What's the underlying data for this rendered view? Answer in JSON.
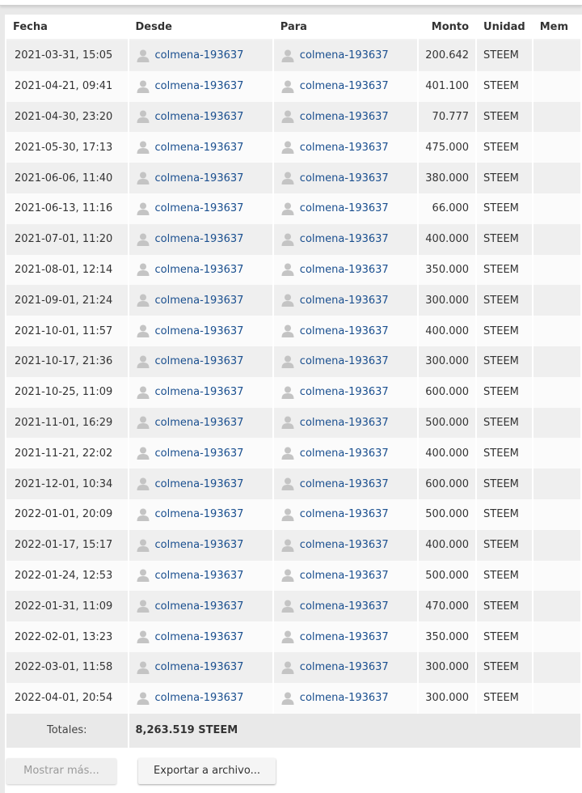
{
  "table": {
    "headers": {
      "fecha": "Fecha",
      "desde": "Desde",
      "para": "Para",
      "monto": "Monto",
      "unidad": "Unidad",
      "memo": "Mem"
    },
    "rows": [
      {
        "fecha": "2021-03-31, 15:05",
        "desde": "colmena-193637",
        "para": "colmena-193637",
        "monto": "200.642",
        "unidad": "STEEM"
      },
      {
        "fecha": "2021-04-21, 09:41",
        "desde": "colmena-193637",
        "para": "colmena-193637",
        "monto": "401.100",
        "unidad": "STEEM"
      },
      {
        "fecha": "2021-04-30, 23:20",
        "desde": "colmena-193637",
        "para": "colmena-193637",
        "monto": "70.777",
        "unidad": "STEEM"
      },
      {
        "fecha": "2021-05-30, 17:13",
        "desde": "colmena-193637",
        "para": "colmena-193637",
        "monto": "475.000",
        "unidad": "STEEM"
      },
      {
        "fecha": "2021-06-06, 11:40",
        "desde": "colmena-193637",
        "para": "colmena-193637",
        "monto": "380.000",
        "unidad": "STEEM"
      },
      {
        "fecha": "2021-06-13, 11:16",
        "desde": "colmena-193637",
        "para": "colmena-193637",
        "monto": "66.000",
        "unidad": "STEEM"
      },
      {
        "fecha": "2021-07-01, 11:20",
        "desde": "colmena-193637",
        "para": "colmena-193637",
        "monto": "400.000",
        "unidad": "STEEM"
      },
      {
        "fecha": "2021-08-01, 12:14",
        "desde": "colmena-193637",
        "para": "colmena-193637",
        "monto": "350.000",
        "unidad": "STEEM"
      },
      {
        "fecha": "2021-09-01, 21:24",
        "desde": "colmena-193637",
        "para": "colmena-193637",
        "monto": "300.000",
        "unidad": "STEEM"
      },
      {
        "fecha": "2021-10-01, 11:57",
        "desde": "colmena-193637",
        "para": "colmena-193637",
        "monto": "400.000",
        "unidad": "STEEM"
      },
      {
        "fecha": "2021-10-17, 21:36",
        "desde": "colmena-193637",
        "para": "colmena-193637",
        "monto": "300.000",
        "unidad": "STEEM"
      },
      {
        "fecha": "2021-10-25, 11:09",
        "desde": "colmena-193637",
        "para": "colmena-193637",
        "monto": "600.000",
        "unidad": "STEEM"
      },
      {
        "fecha": "2021-11-01, 16:29",
        "desde": "colmena-193637",
        "para": "colmena-193637",
        "monto": "500.000",
        "unidad": "STEEM"
      },
      {
        "fecha": "2021-11-21, 22:02",
        "desde": "colmena-193637",
        "para": "colmena-193637",
        "monto": "400.000",
        "unidad": "STEEM"
      },
      {
        "fecha": "2021-12-01, 10:34",
        "desde": "colmena-193637",
        "para": "colmena-193637",
        "monto": "600.000",
        "unidad": "STEEM"
      },
      {
        "fecha": "2022-01-01, 20:09",
        "desde": "colmena-193637",
        "para": "colmena-193637",
        "monto": "500.000",
        "unidad": "STEEM"
      },
      {
        "fecha": "2022-01-17, 15:17",
        "desde": "colmena-193637",
        "para": "colmena-193637",
        "monto": "400.000",
        "unidad": "STEEM"
      },
      {
        "fecha": "2022-01-24, 12:53",
        "desde": "colmena-193637",
        "para": "colmena-193637",
        "monto": "500.000",
        "unidad": "STEEM"
      },
      {
        "fecha": "2022-01-31, 11:09",
        "desde": "colmena-193637",
        "para": "colmena-193637",
        "monto": "470.000",
        "unidad": "STEEM"
      },
      {
        "fecha": "2022-02-01, 13:23",
        "desde": "colmena-193637",
        "para": "colmena-193637",
        "monto": "350.000",
        "unidad": "STEEM"
      },
      {
        "fecha": "2022-03-01, 11:58",
        "desde": "colmena-193637",
        "para": "colmena-193637",
        "monto": "300.000",
        "unidad": "STEEM"
      },
      {
        "fecha": "2022-04-01, 20:54",
        "desde": "colmena-193637",
        "para": "colmena-193637",
        "monto": "300.000",
        "unidad": "STEEM"
      }
    ],
    "totals": {
      "label": "Totales:",
      "value": "8,263.519 STEEM"
    }
  },
  "buttons": {
    "show_more": "Mostrar más...",
    "export": "Exportar a archivo..."
  },
  "icons": {
    "user": "user-icon"
  },
  "colors": {
    "link": "#1a4f8f",
    "row_odd": "#efefef",
    "row_even": "#fbfbfb",
    "background": "#e9e9e9"
  }
}
